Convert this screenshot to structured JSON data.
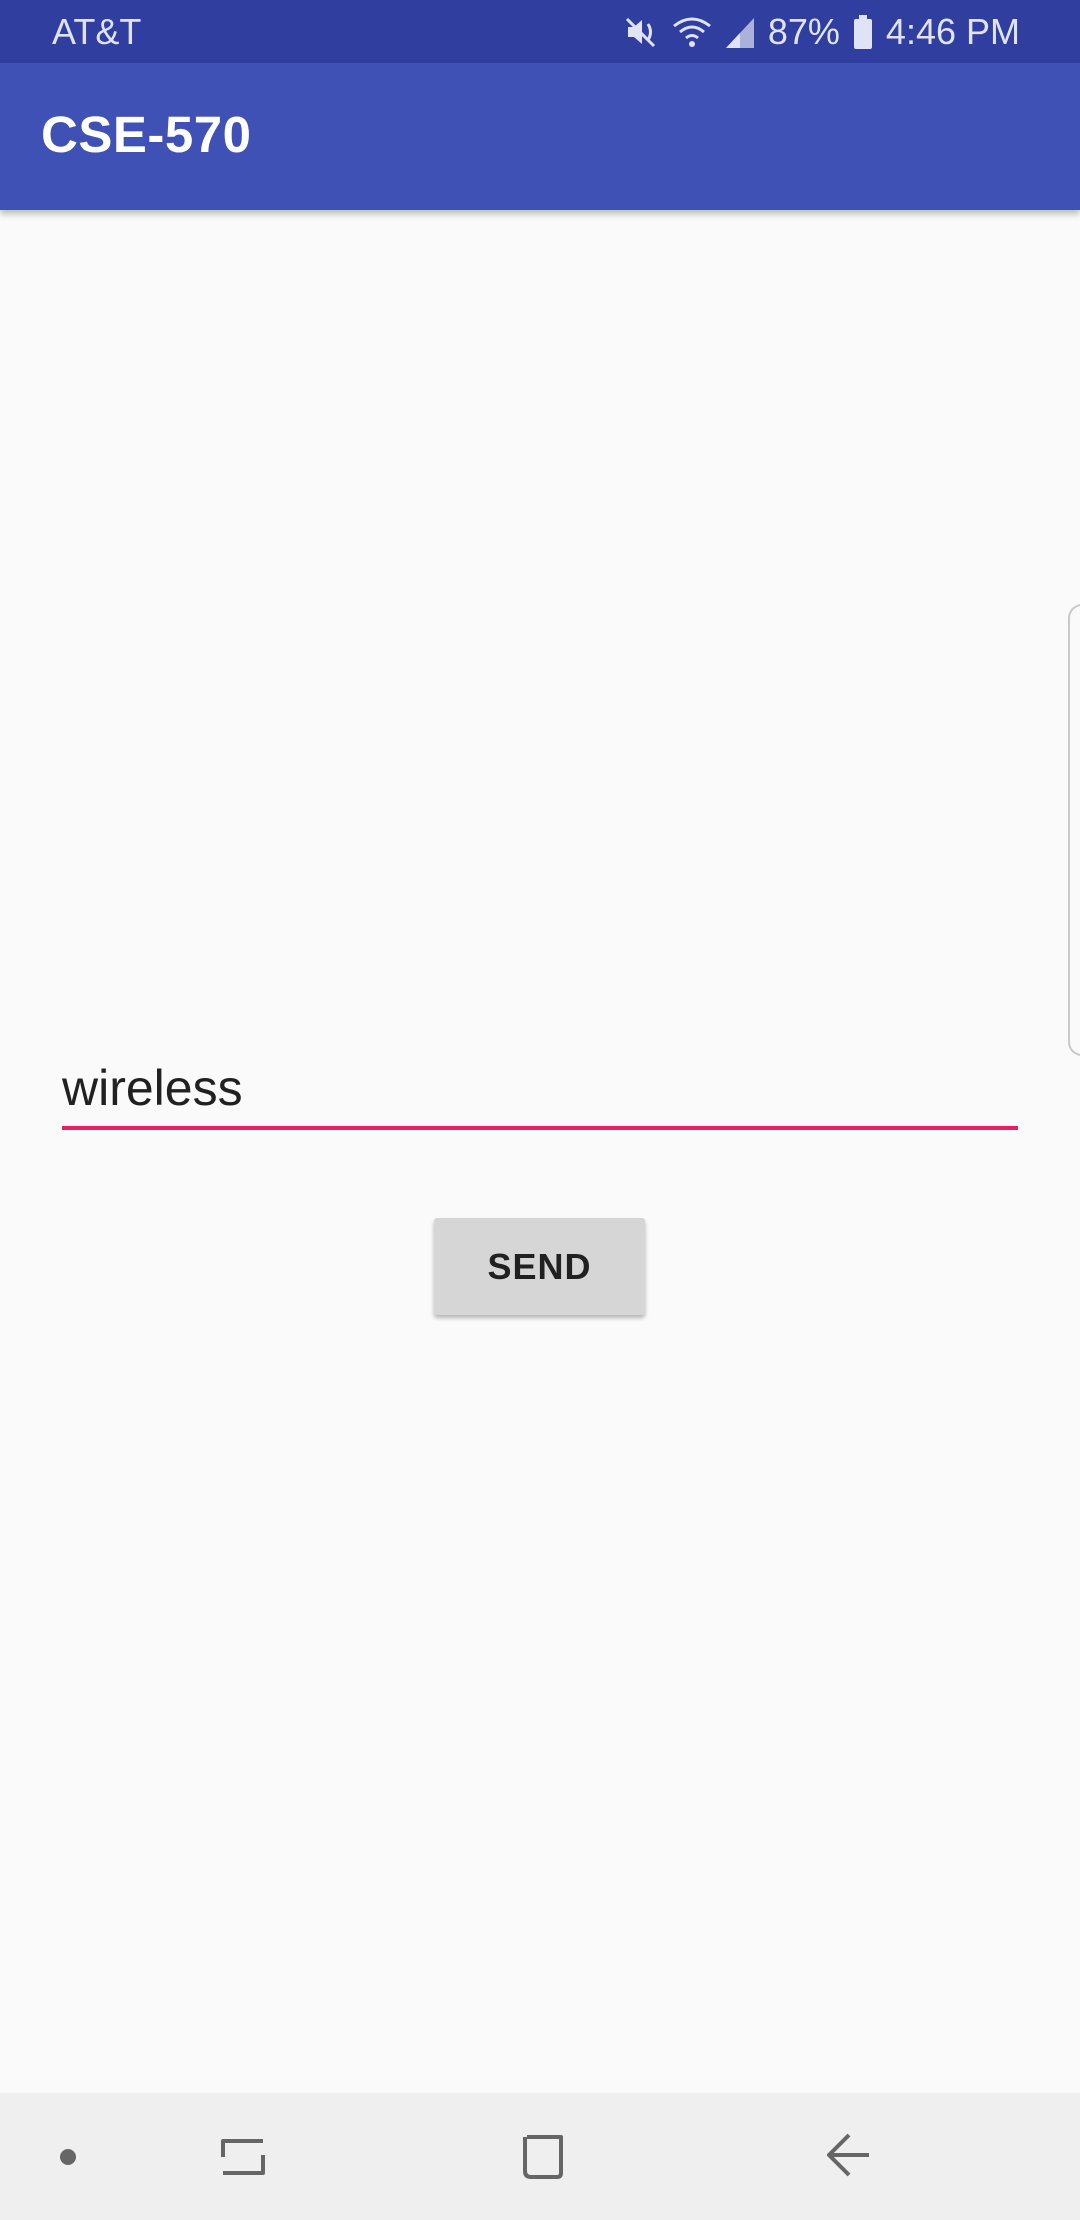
{
  "status_bar": {
    "carrier": "AT&T",
    "battery_percent": "87%",
    "time": "4:46 PM",
    "icons": [
      "mute-vibrate-icon",
      "wifi-icon",
      "signal-icon",
      "battery-icon"
    ]
  },
  "app_bar": {
    "title": "CSE-570",
    "color": "#3f51b5"
  },
  "form": {
    "input_value": "wireless",
    "underline_color": "#e91e63",
    "send_label": "SEND"
  },
  "nav_bar": {
    "buttons": [
      "dot-icon",
      "recent-apps-icon",
      "home-icon",
      "back-icon"
    ]
  }
}
